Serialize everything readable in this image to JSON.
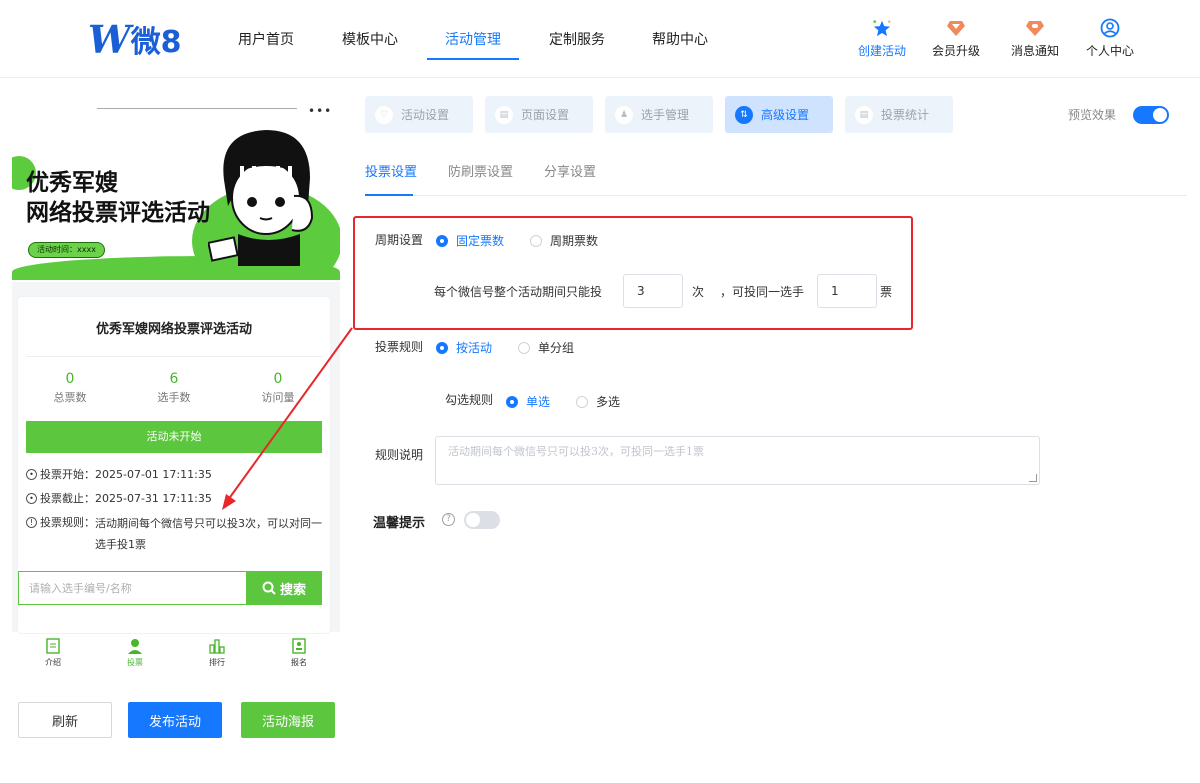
{
  "header": {
    "logo_mark": "W",
    "logo_text": "微8",
    "nav": [
      {
        "label": "用户首页"
      },
      {
        "label": "模板中心"
      },
      {
        "label": "活动管理"
      },
      {
        "label": "定制服务"
      },
      {
        "label": "帮助中心"
      }
    ],
    "active_nav": "活动管理",
    "quick": [
      {
        "label": "创建活动",
        "icon": "star-badge-icon"
      },
      {
        "label": "会员升级",
        "icon": "vip-diamond-icon"
      },
      {
        "label": "消息通知",
        "icon": "bell-diamond-icon"
      },
      {
        "label": "个人中心",
        "icon": "user-circle-icon"
      }
    ],
    "colors": {
      "accent": "#1677ff",
      "green": "#5cc63e"
    }
  },
  "preview": {
    "dots": "•••",
    "banner_title_line1": "优秀军嫂",
    "banner_title_line2": "网络投票评选活动",
    "banner_time": "活动时间：xxxx",
    "card_title": "优秀军嫂网络投票评选活动",
    "stats": [
      {
        "value": "0",
        "label": "总票数"
      },
      {
        "value": "6",
        "label": "选手数"
      },
      {
        "value": "0",
        "label": "访问量"
      }
    ],
    "status": "活动未开始",
    "vote_start_label": "投票开始：",
    "vote_start": "2025-07-01 17:11:35",
    "vote_end_label": "投票截止：",
    "vote_end": "2025-07-31 17:11:35",
    "vote_rule_label": "投票规则：",
    "vote_rule": "活动期间每个微信号只可以投3次，可以对同一选手投1票",
    "search_placeholder": "请输入选手编号/名称",
    "search_button": "搜索",
    "tabbar": [
      {
        "label": "介绍",
        "icon": "doc-icon"
      },
      {
        "label": "投票",
        "icon": "person-icon"
      },
      {
        "label": "排行",
        "icon": "bar-rank-icon"
      },
      {
        "label": "报名",
        "icon": "signup-icon"
      }
    ],
    "buttons": {
      "refresh": "刷新",
      "publish": "发布活动",
      "poster": "活动海报"
    }
  },
  "steps": [
    {
      "label": "活动设置",
      "icon": "heart-icon"
    },
    {
      "label": "页面设置",
      "icon": "page-icon"
    },
    {
      "label": "选手管理",
      "icon": "user-icon"
    },
    {
      "label": "高级设置",
      "icon": "sliders-icon"
    },
    {
      "label": "投票统计",
      "icon": "chart-icon"
    }
  ],
  "active_step": "高级设置",
  "preview_effect_label": "预览效果",
  "preview_effect_on": true,
  "subtabs": [
    {
      "label": "投票设置"
    },
    {
      "label": "防刷票设置"
    },
    {
      "label": "分享设置"
    }
  ],
  "active_subtab": "投票设置",
  "form": {
    "period_label": "周期设置",
    "period_options": [
      "固定票数",
      "周期票数"
    ],
    "period_selected": "固定票数",
    "limit_prefix": "每个微信号整个活动期间只能投",
    "limit_times": "3",
    "limit_times_unit": "次",
    "limit_mid": "，可投同一选手",
    "limit_per_player": "1",
    "limit_per_player_unit": "票",
    "rule_label": "投票规则",
    "rule_options": [
      "按活动",
      "单分组"
    ],
    "rule_selected": "按活动",
    "check_label": "勾选规则",
    "check_options": [
      "单选",
      "多选"
    ],
    "check_selected": "单选",
    "desc_label": "规则说明",
    "desc_placeholder": "活动期间每个微信号只可以投3次，可投同一选手1票",
    "tip_label": "温馨提示",
    "tip_enabled": false
  }
}
